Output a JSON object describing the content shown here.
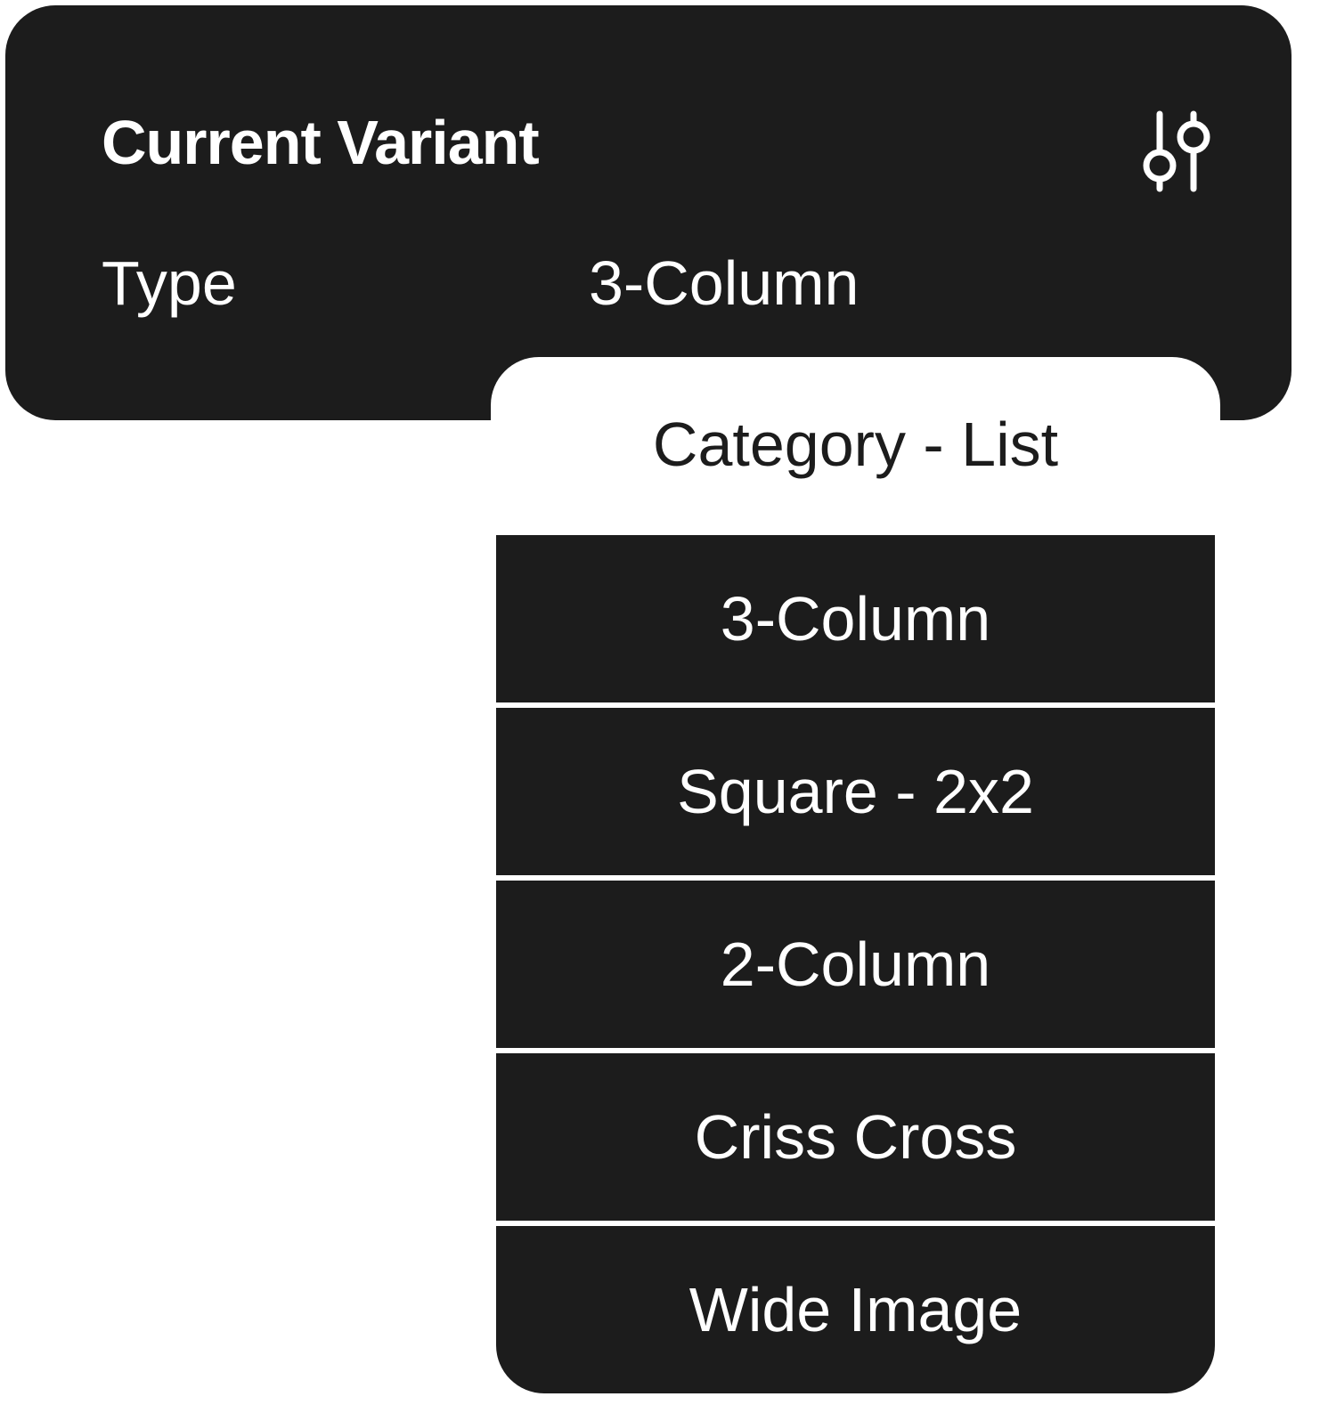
{
  "panel": {
    "title": "Current Variant",
    "filter_icon": "sliders-icon",
    "type_label": "Type",
    "type_value": "3-Column"
  },
  "dropdown": {
    "header_label": "Category - List",
    "options": [
      {
        "label": "3-Column"
      },
      {
        "label": "Square - 2x2"
      },
      {
        "label": "2-Column"
      },
      {
        "label": "Criss Cross"
      },
      {
        "label": "Wide Image"
      }
    ]
  },
  "colors": {
    "panel_bg": "#1c1c1c",
    "text_light": "#ffffff",
    "text_dark": "#1c1c1c",
    "page_bg": "#ffffff"
  }
}
